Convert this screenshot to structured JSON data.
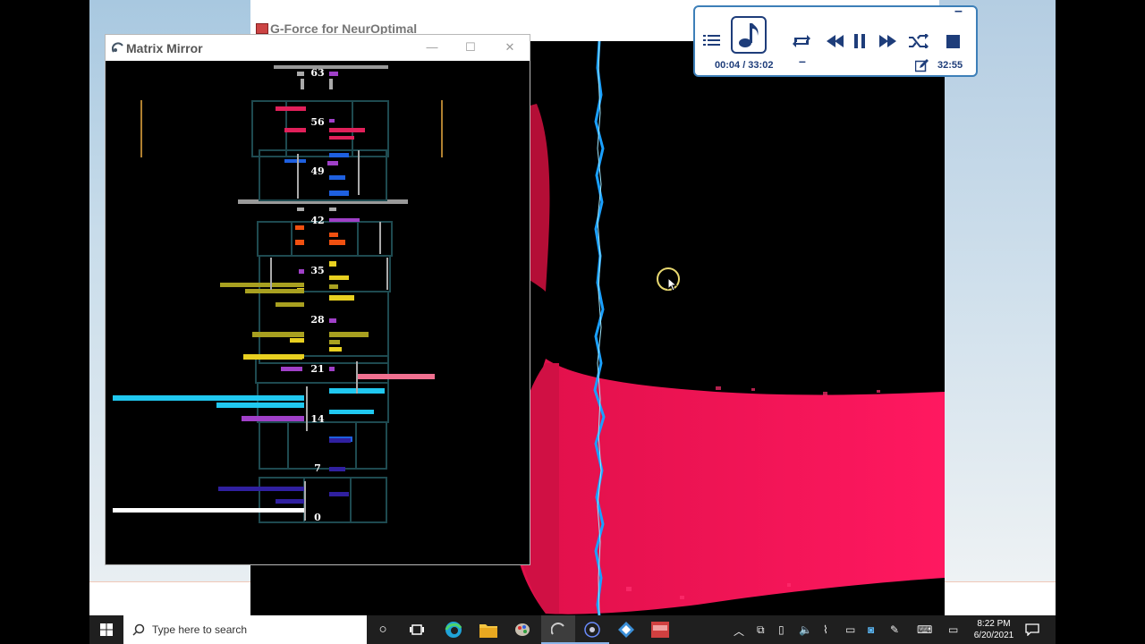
{
  "gforce": {
    "title": "G-Force for NeurOptimal"
  },
  "matrix_mirror": {
    "title": "Matrix Mirror",
    "window_buttons": {
      "minimize": "—",
      "maximize": "☐",
      "close": "✕"
    },
    "row_labels": [
      "63",
      "56",
      "49",
      "42",
      "35",
      "28",
      "21",
      "14",
      "7",
      "0"
    ]
  },
  "player": {
    "elapsed_total": "00:04 / 33:02",
    "remaining": "32:55",
    "minimize": "–",
    "volume": "–",
    "icons": {
      "playlist": "playlist-icon",
      "note": "music-note-icon",
      "repeat": "repeat-icon",
      "previous": "previous-icon",
      "pause": "pause-icon",
      "next": "next-icon",
      "shuffle": "shuffle-icon",
      "stop": "stop-icon",
      "edit": "edit-icon"
    }
  },
  "taskbar": {
    "search_placeholder": "Type here to search",
    "time": "8:22 PM",
    "date": "6/20/2021"
  }
}
